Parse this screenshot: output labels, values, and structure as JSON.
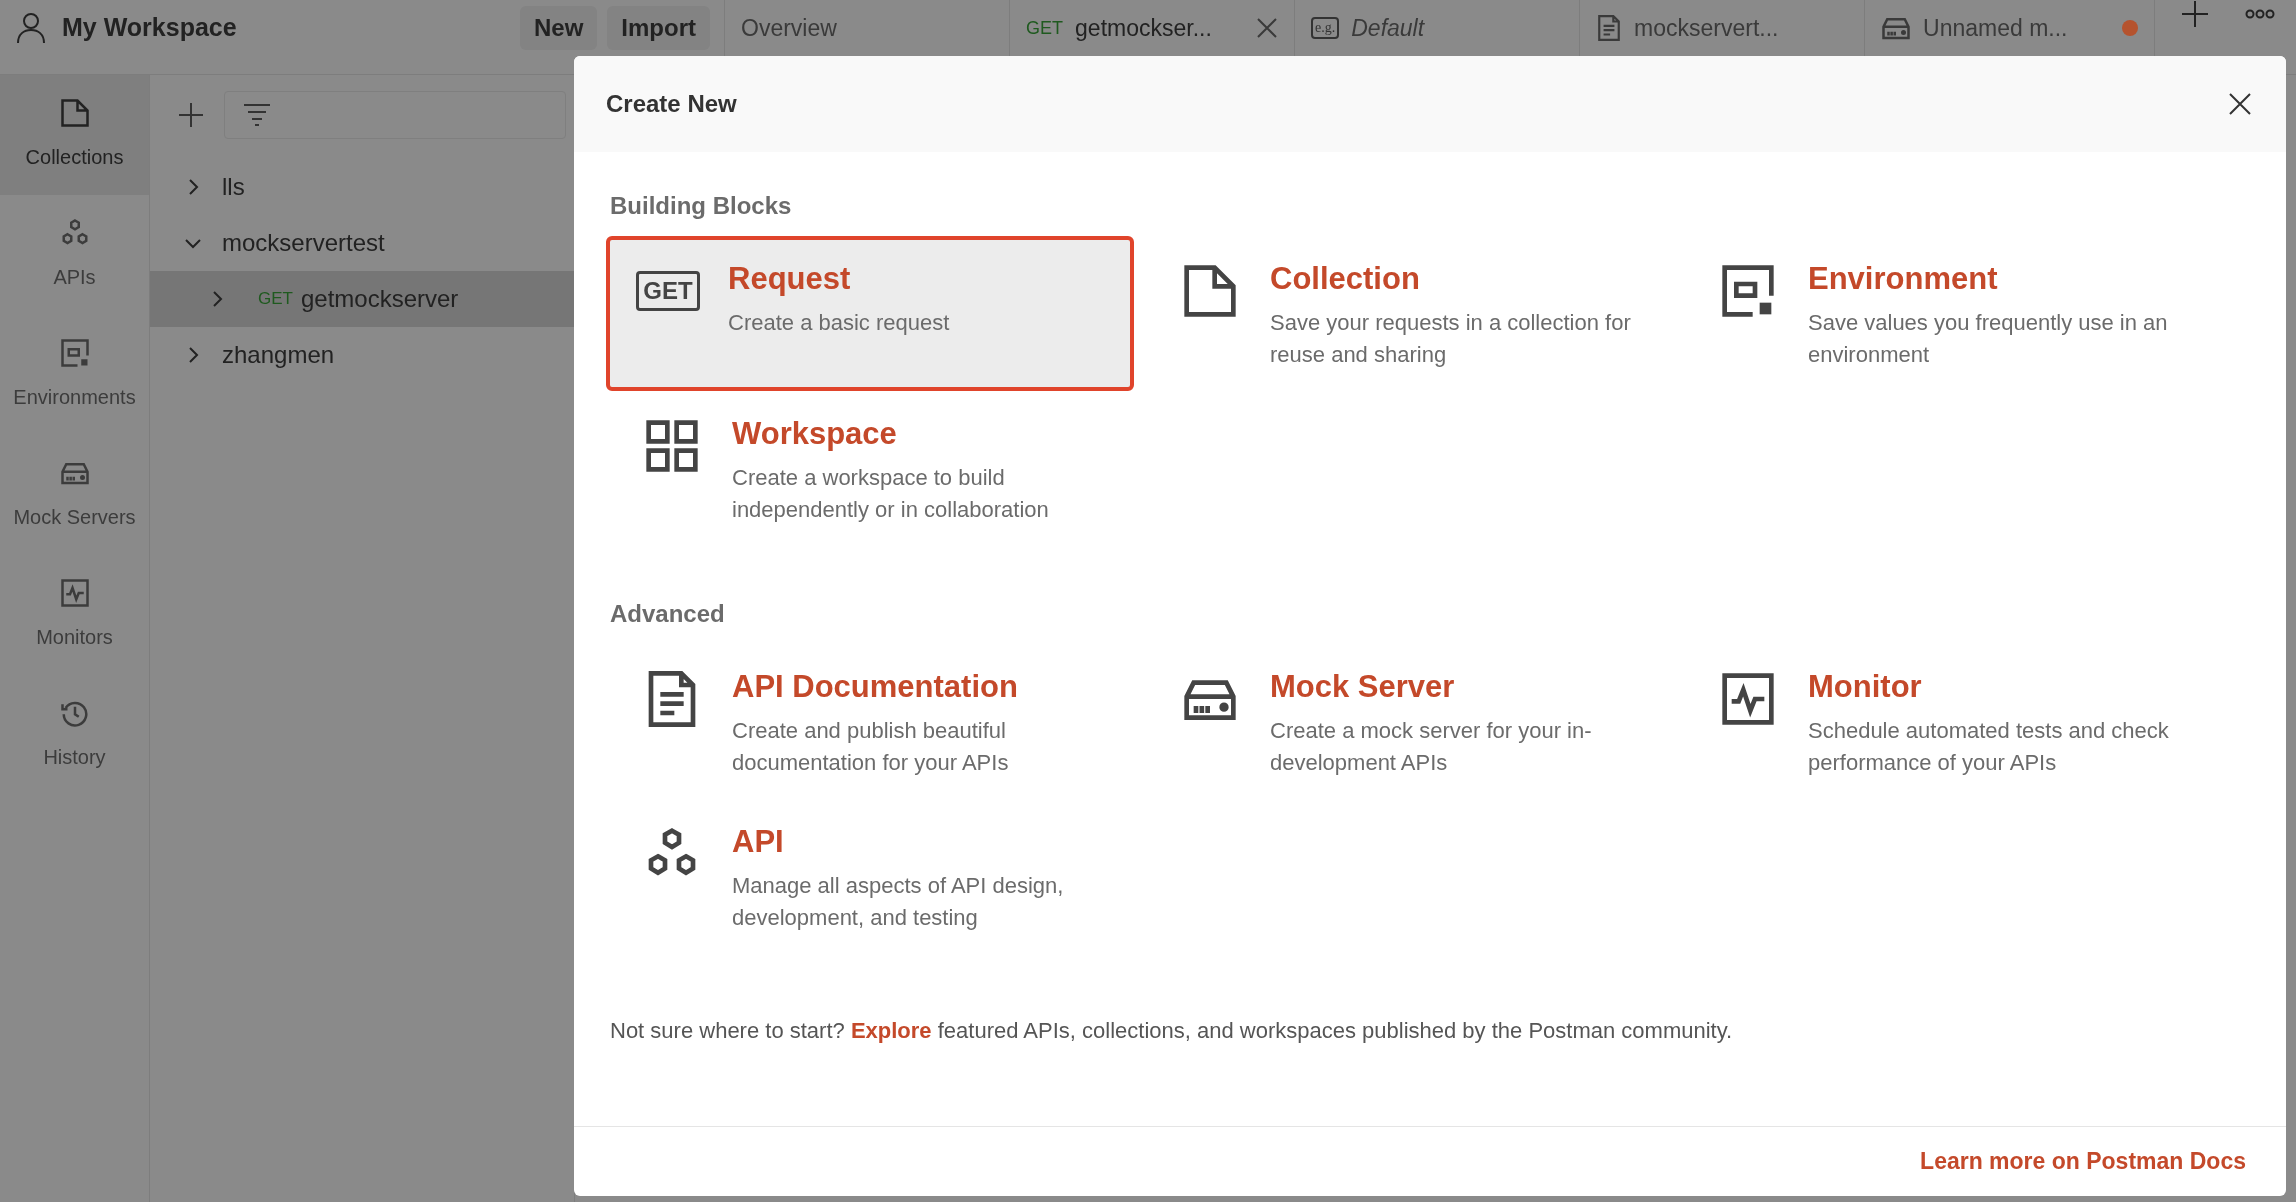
{
  "header": {
    "workspace": "My Workspace",
    "buttons": [
      "New",
      "Import"
    ]
  },
  "tabs": [
    {
      "kind": "overview",
      "label": "Overview"
    },
    {
      "kind": "request",
      "method": "GET",
      "label": "getmockser...",
      "closable": true
    },
    {
      "kind": "environment",
      "badge": "e.g.",
      "label": "Default"
    },
    {
      "kind": "document",
      "label": "mockservert..."
    },
    {
      "kind": "mock",
      "label": "Unnamed m...",
      "unsaved": true
    }
  ],
  "rail": [
    {
      "kind": "collection",
      "label": "Collections",
      "selected": true
    },
    {
      "kind": "api",
      "label": "APIs",
      "selected": false
    },
    {
      "kind": "environment",
      "label": "Environments",
      "selected": false
    },
    {
      "kind": "mock",
      "label": "Mock Servers",
      "selected": false
    },
    {
      "kind": "monitor",
      "label": "Monitors",
      "selected": false
    },
    {
      "kind": "history",
      "label": "History",
      "selected": false
    }
  ],
  "tree": [
    {
      "label": "lls",
      "expanded": false,
      "selected": false
    },
    {
      "label": "mockservertest",
      "expanded": true,
      "selected": false,
      "children": [
        {
          "label": "getmockserver",
          "method": "GET",
          "expanded": false,
          "selected": true
        }
      ]
    },
    {
      "label": "zhangmen",
      "expanded": false,
      "selected": false
    }
  ],
  "modal": {
    "title": "Create New",
    "sections": [
      {
        "title": "Building Blocks",
        "items": [
          {
            "kind": "request",
            "badge": "GET",
            "title": "Request",
            "description": "Create a basic request",
            "selected": true
          },
          {
            "kind": "collection",
            "title": "Collection",
            "description": "Save your requests in a collection for reuse and sharing",
            "selected": false
          },
          {
            "kind": "environment",
            "title": "Environment",
            "description": "Save values you frequently use in an environment",
            "selected": false
          },
          {
            "kind": "workspace",
            "title": "Workspace",
            "description": "Create a workspace to build independently or in collaboration",
            "selected": false
          }
        ]
      },
      {
        "title": "Advanced",
        "items": [
          {
            "kind": "document",
            "title": "API Documentation",
            "description": "Create and publish beautiful documentation for your APIs",
            "selected": false
          },
          {
            "kind": "mock",
            "title": "Mock Server",
            "description": "Create a mock server for your in-development APIs",
            "selected": false
          },
          {
            "kind": "monitor",
            "title": "Monitor",
            "description": "Schedule automated tests and check performance of your APIs",
            "selected": false
          },
          {
            "kind": "api",
            "title": "API",
            "description": "Manage all aspects of API design, development, and testing",
            "selected": false
          }
        ]
      }
    ],
    "note": {
      "before": "Not sure where to start?",
      "link": "Explore",
      "after": "featured APIs, collections, and workspaces published by the Postman community."
    },
    "footer_link": "Learn more on Postman Docs"
  }
}
